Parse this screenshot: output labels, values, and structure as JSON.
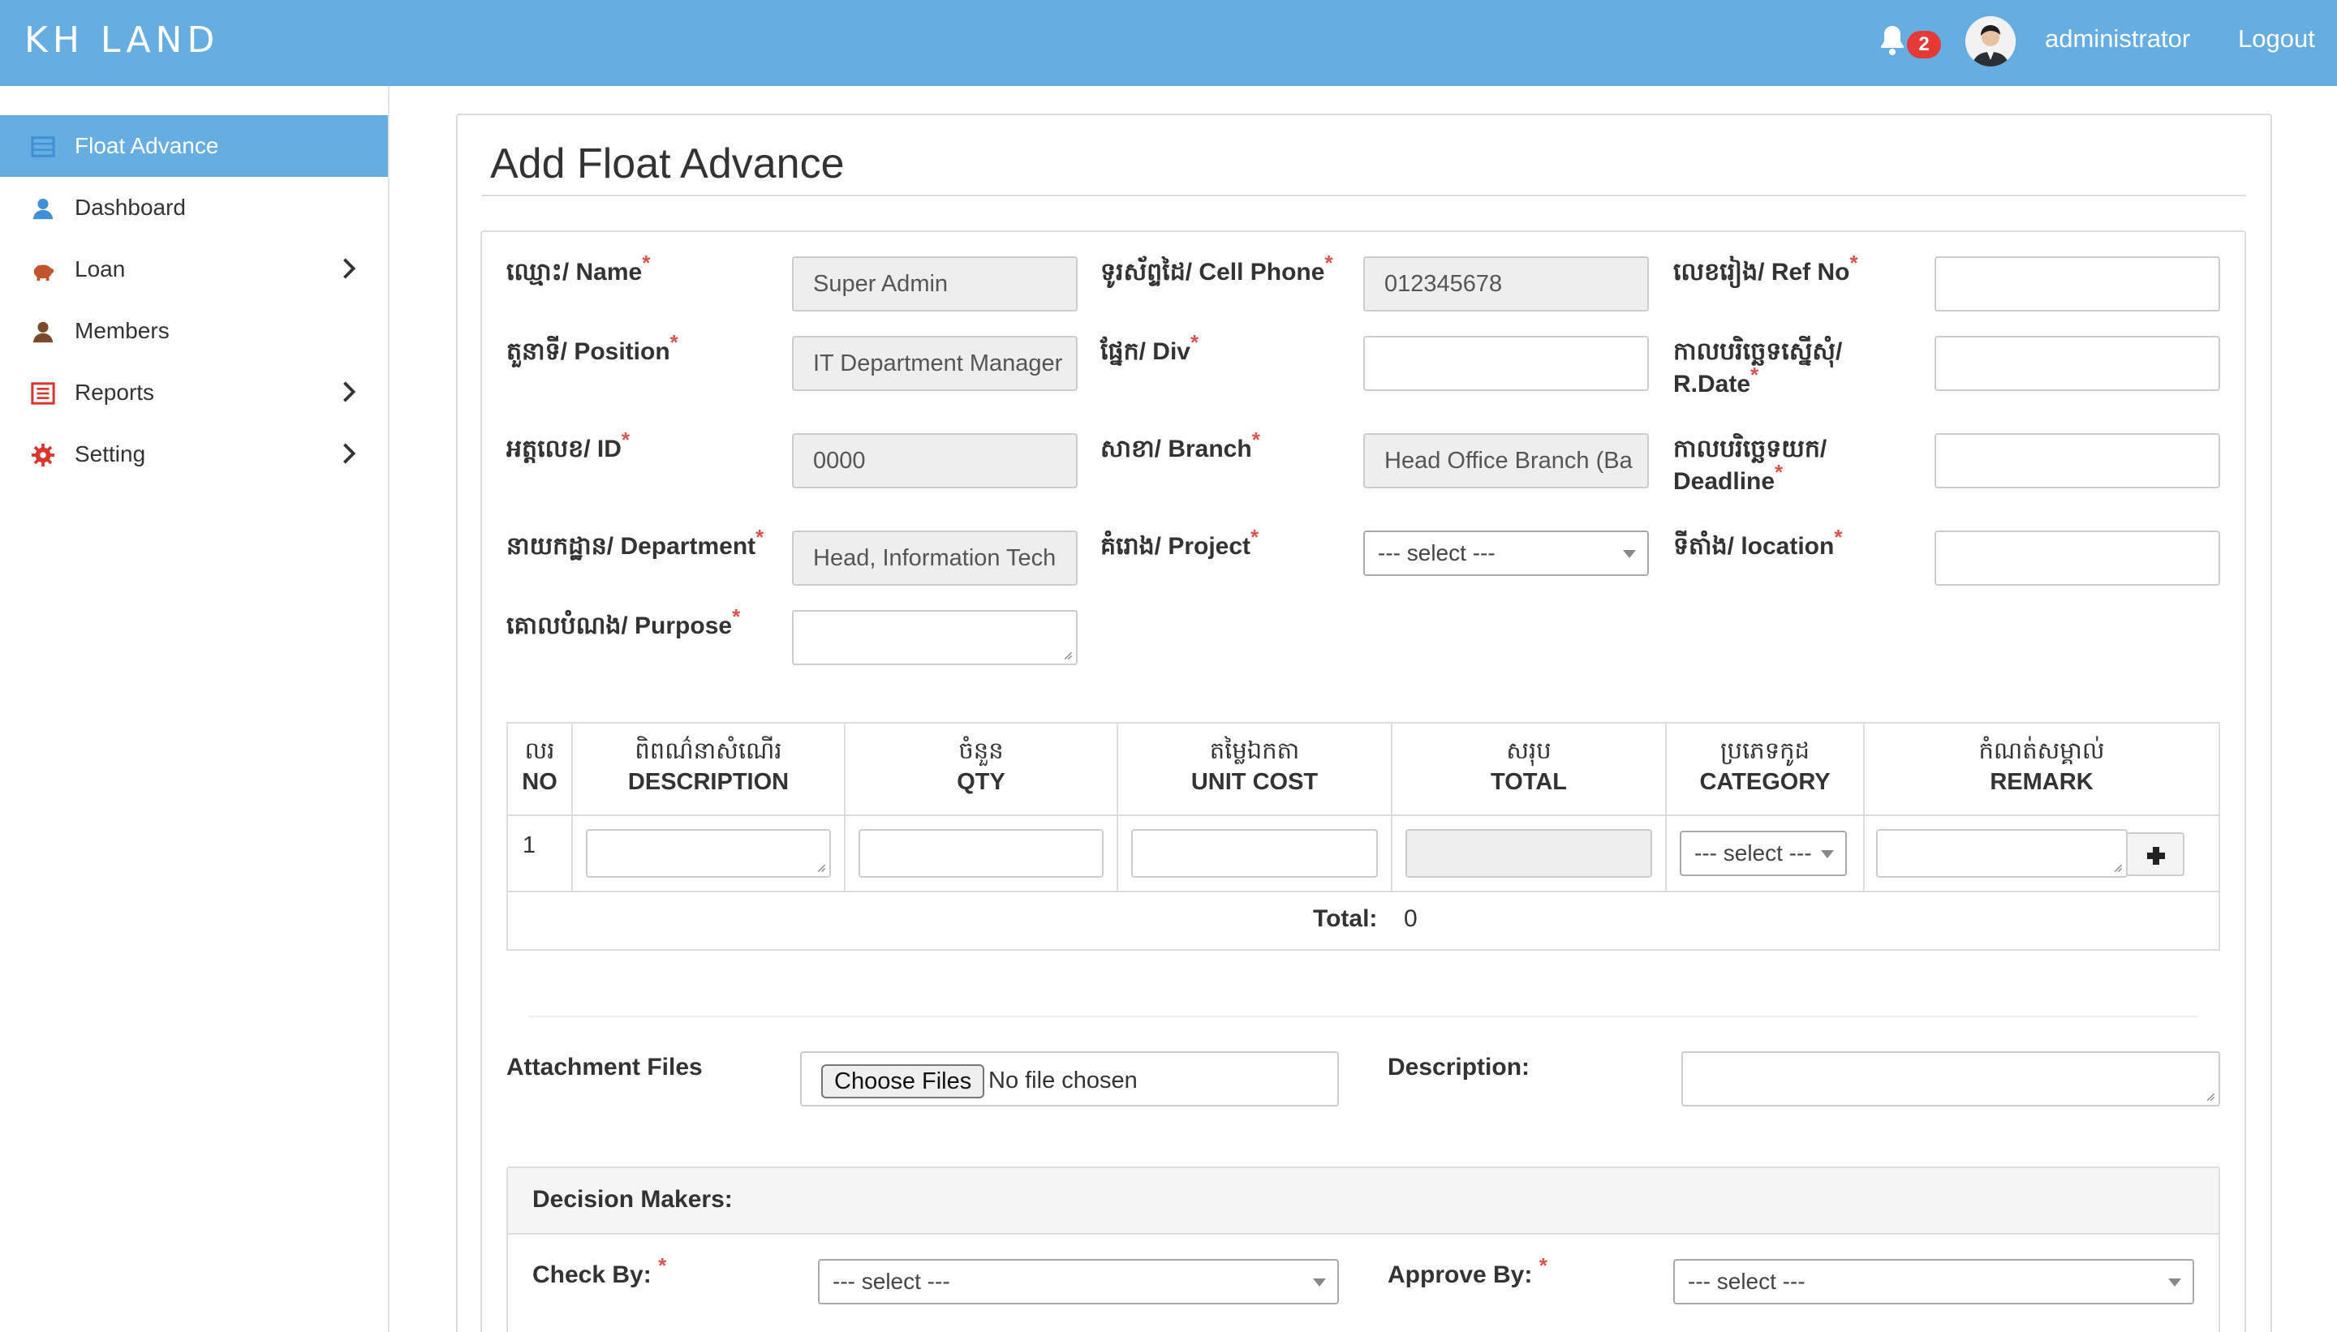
{
  "app": {
    "brand": "KH LAND"
  },
  "header": {
    "notification_count": "2",
    "username": "administrator",
    "logout_label": "Logout"
  },
  "sidebar": {
    "items": [
      {
        "label": "Float Advance",
        "icon": "table-icon",
        "active": true
      },
      {
        "label": "Dashboard",
        "icon": "user-icon"
      },
      {
        "label": "Loan",
        "icon": "piggy-bank-icon",
        "has_children": true
      },
      {
        "label": "Members",
        "icon": "user-icon"
      },
      {
        "label": "Reports",
        "icon": "list-icon",
        "has_children": true
      },
      {
        "label": "Setting",
        "icon": "gear-icon",
        "has_children": true
      }
    ]
  },
  "page": {
    "title": "Add Float Advance"
  },
  "form": {
    "name": {
      "label": "ឈ្មោះ/ Name",
      "value": "Super Admin"
    },
    "cell_phone": {
      "label": "ទូរស័ព្ទដៃ/ Cell Phone",
      "value": "012345678"
    },
    "ref_no": {
      "label": "លេខរៀង/ Ref No",
      "value": ""
    },
    "position": {
      "label": "តួនាទី/ Position",
      "value": "IT Department Manager"
    },
    "div": {
      "label": "ផ្នែក/ Div",
      "value": ""
    },
    "r_date": {
      "label_line1": "កាលបរិច្ឆេទស្នើសុំ/",
      "label_line2": "R.Date",
      "value": ""
    },
    "id": {
      "label": "អត្តលេខ/ ID",
      "value": "0000"
    },
    "branch": {
      "label": "សាខា/ Branch",
      "value": "Head Office Branch (Ba"
    },
    "deadline": {
      "label_line1": "កាលបរិច្ឆេទយក/",
      "label_line2": "Deadline",
      "value": ""
    },
    "department": {
      "label": "នាយកដ្ឋាន/ Department",
      "value": "Head, Information Tech"
    },
    "project": {
      "label": "គំរោង/ Project",
      "selected": "--- select ---"
    },
    "location": {
      "label": "ទីតាំង/ location",
      "value": ""
    },
    "purpose": {
      "label": "គោលបំណង/ Purpose",
      "value": ""
    }
  },
  "table": {
    "columns": [
      {
        "kh": "លរ",
        "en": "NO"
      },
      {
        "kh": "ពិពណ៌នាសំណើរ",
        "en": "DESCRIPTION"
      },
      {
        "kh": "ចំនួន",
        "en": "QTY"
      },
      {
        "kh": "តម្លៃឯកតា",
        "en": "UNIT COST"
      },
      {
        "kh": "សរុប",
        "en": "TOTAL"
      },
      {
        "kh": "ប្រភេទកូដ",
        "en": "CATEGORY"
      },
      {
        "kh": "កំណត់សម្គាល់",
        "en": "REMARK"
      }
    ],
    "rows": [
      {
        "no": "1",
        "category": "--- select ---"
      }
    ],
    "total_label": "Total:",
    "total_value": "0"
  },
  "attachment": {
    "label": "Attachment Files",
    "button_label": "Choose Files",
    "status": "No file chosen",
    "description_label": "Description:"
  },
  "decision_makers": {
    "title": "Decision Makers:",
    "check_by_label": "Check By:",
    "check_by_selected": "--- select ---",
    "approve_by_label": "Approve By:",
    "approve_by_selected": "--- select ---"
  },
  "colors": {
    "topbar": "#66ade2",
    "required": "#d9534f",
    "badge": "#e53935"
  }
}
